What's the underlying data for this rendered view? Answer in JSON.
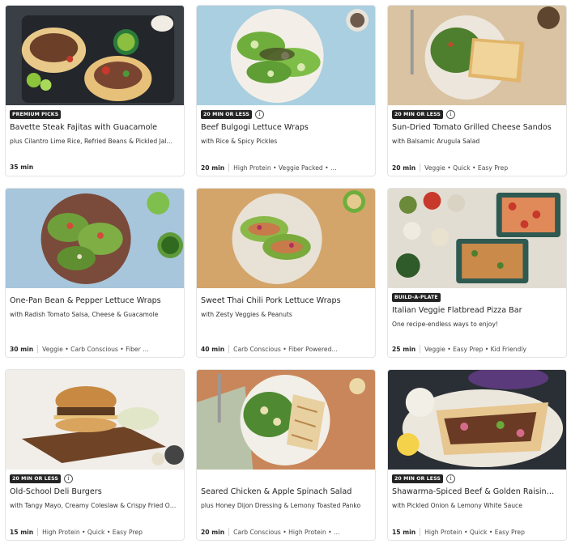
{
  "recipes": [
    {
      "badge": "PREMIUM PICKS",
      "has_info": false,
      "title": "Bavette Steak Fajitas with Guacamole",
      "subtitle": "plus Cilantro Lime Rice, Refried Beans & Pickled Jal…",
      "time": "35 min",
      "tags": ""
    },
    {
      "badge": "20 MIN OR LESS",
      "has_info": true,
      "title": "Beef Bulgogi Lettuce Wraps",
      "subtitle": "with Rice & Spicy Pickles",
      "time": "20 min",
      "tags": "High Protein • Veggie Packed • …"
    },
    {
      "badge": "20 MIN OR LESS",
      "has_info": true,
      "title": "Sun-Dried Tomato Grilled Cheese Sandos",
      "subtitle": "with Balsamic Arugula Salad",
      "time": "20 min",
      "tags": "Veggie • Quick • Easy Prep"
    },
    {
      "badge": "",
      "has_info": false,
      "title": "One-Pan Bean & Pepper Lettuce Wraps",
      "subtitle": "with Radish Tomato Salsa, Cheese & Guacamole",
      "time": "30 min",
      "tags": "Veggie • Carb Conscious • Fiber …"
    },
    {
      "badge": "",
      "has_info": false,
      "title": "Sweet Thai Chili Pork Lettuce Wraps",
      "subtitle": "with Zesty Veggies & Peanuts",
      "time": "40 min",
      "tags": "Carb Conscious • Fiber Powered…"
    },
    {
      "badge": "BUILD-A-PLATE",
      "has_info": false,
      "title": "Italian Veggie Flatbread Pizza Bar",
      "subtitle": "One recipe-endless ways to enjoy!",
      "time": "25 min",
      "tags": "Veggie • Easy Prep • Kid Friendly"
    },
    {
      "badge": "20 MIN OR LESS",
      "has_info": true,
      "title": "Old-School Deli Burgers",
      "subtitle": "with Tangy Mayo, Creamy Coleslaw & Crispy Fried O…",
      "time": "15 min",
      "tags": "High Protein • Quick • Easy Prep"
    },
    {
      "badge": "",
      "has_info": false,
      "title": "Seared Chicken & Apple Spinach Salad",
      "subtitle": "plus Honey Dijon Dressing & Lemony Toasted Panko",
      "time": "20 min",
      "tags": "Carb Conscious • High Protein • …"
    },
    {
      "badge": "20 MIN OR LESS",
      "has_info": true,
      "title": "Shawarma-Spiced Beef & Golden Raisin…",
      "subtitle": "with Pickled Onion & Lemony White Sauce",
      "time": "15 min",
      "tags": "High Protein • Quick • Easy Prep"
    }
  ],
  "info_glyph": "i",
  "colors": {
    "badge_bg": "#242424",
    "border": "#e4e4e4"
  }
}
